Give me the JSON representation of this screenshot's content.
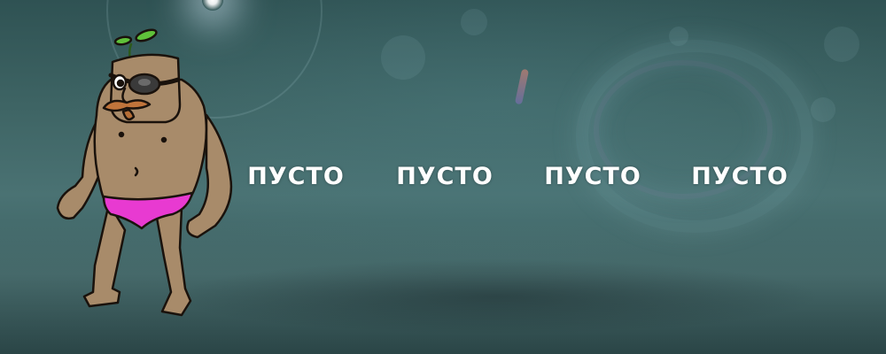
{
  "slots": [
    {
      "label": "ПУСТО"
    },
    {
      "label": "ПУСТО"
    },
    {
      "label": "ПУСТО"
    },
    {
      "label": "ПУСТО"
    }
  ],
  "character": {
    "name": ""
  },
  "colors": {
    "background": "#3e6464",
    "skin": "#a88b6a",
    "briefs": "#e83ad1",
    "sprout": "#5fc13a",
    "text": "#ffffff"
  }
}
